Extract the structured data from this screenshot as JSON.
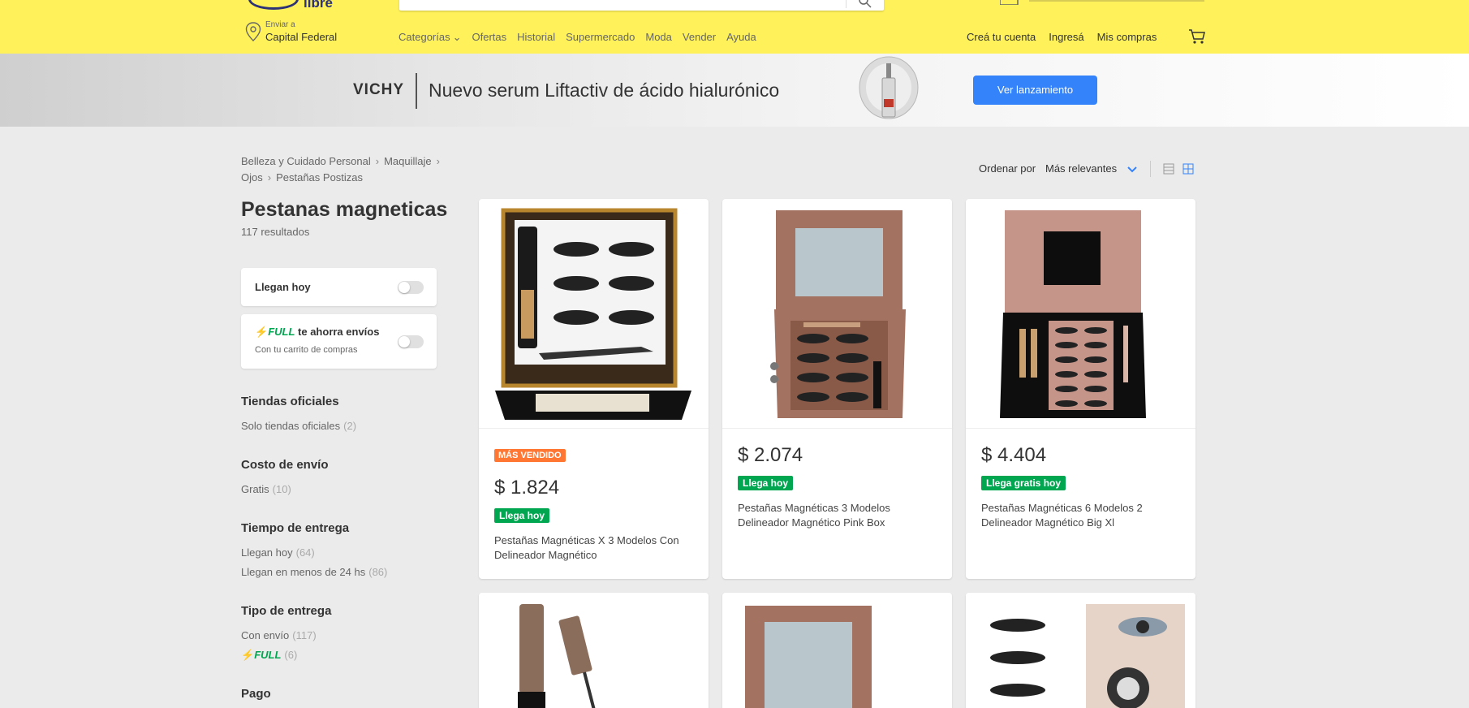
{
  "header": {
    "logo_text": "libre",
    "location_label": "Enviar a",
    "location_value": "Capital Federal",
    "nav": [
      "Categorías",
      "Ofertas",
      "Historial",
      "Supermercado",
      "Moda",
      "Vender",
      "Ayuda"
    ],
    "account": [
      "Creá tu cuenta",
      "Ingresá",
      "Mis compras"
    ],
    "brand_color": "#fff159"
  },
  "banner": {
    "brand": "VICHY",
    "text": "Nuevo serum Liftactiv de ácido hialurónico",
    "button": "Ver lanzamiento"
  },
  "breadcrumb": [
    "Belleza y Cuidado Personal",
    "Maquillaje",
    "Ojos",
    "Pestañas Postizas"
  ],
  "results": {
    "title": "Pestanas magneticas",
    "count": "117 resultados"
  },
  "filters": {
    "toggle_today": "Llegan hoy",
    "full_label": "FULL",
    "full_text": "te ahorra envíos",
    "full_sub": "Con tu carrito de compras",
    "sections": [
      {
        "title": "Tiendas oficiales",
        "items": [
          {
            "label": "Solo tiendas oficiales",
            "count": "(2)"
          }
        ]
      },
      {
        "title": "Costo de envío",
        "items": [
          {
            "label": "Gratis",
            "count": "(10)"
          }
        ]
      },
      {
        "title": "Tiempo de entrega",
        "items": [
          {
            "label": "Llegan hoy",
            "count": "(64)"
          },
          {
            "label": "Llegan en menos de 24 hs",
            "count": "(86)"
          }
        ]
      },
      {
        "title": "Tipo de entrega",
        "items": [
          {
            "label": "Con envío",
            "count": "(117)"
          },
          {
            "label": "FULL",
            "count": "(6)"
          }
        ]
      },
      {
        "title": "Pago",
        "items": []
      }
    ]
  },
  "sort": {
    "label": "Ordenar por",
    "value": "Más relevantes"
  },
  "products": [
    {
      "badge": "MÁS VENDIDO",
      "price": "$ 1.824",
      "shipping": "Llega hoy",
      "title": "Pestañas Magnéticas X 3 Modelos Con Delineador Magnético"
    },
    {
      "badge": "",
      "price": "$ 2.074",
      "shipping": "Llega hoy",
      "title": "Pestañas Magnéticas 3 Modelos Delineador Magnético Pink Box"
    },
    {
      "badge": "",
      "price": "$ 4.404",
      "shipping": "Llega gratis hoy",
      "title": "Pestañas Magnéticas 6 Modelos 2 Delineador Magnético Big Xl"
    }
  ],
  "colors": {
    "accent": "#3483fa",
    "shipping_green": "#00a650",
    "best_seller_orange": "#ff7733"
  }
}
